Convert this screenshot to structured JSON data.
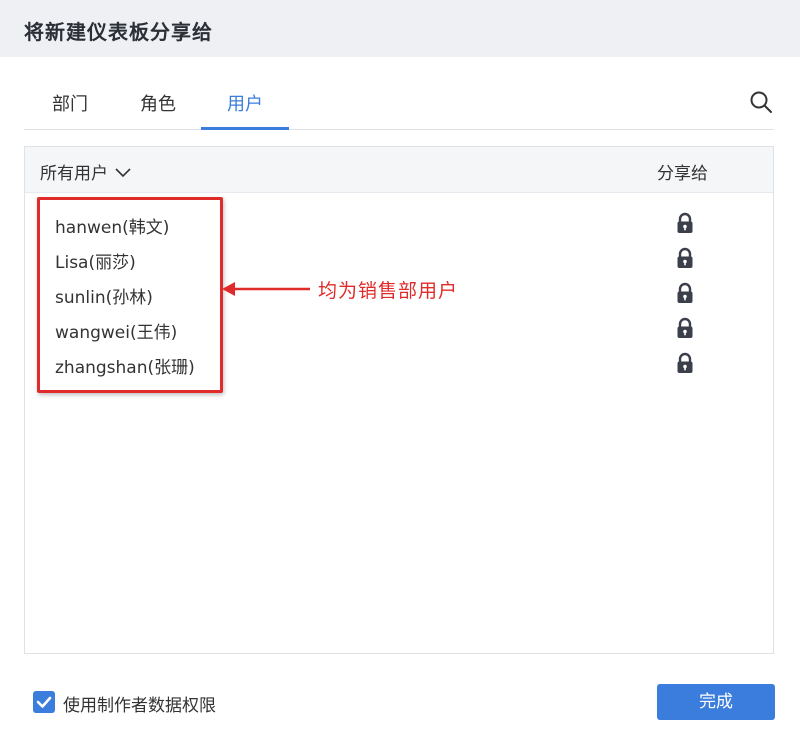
{
  "dialog": {
    "title": "将新建仪表板分享给"
  },
  "tabs": [
    {
      "label": "部门",
      "active": false
    },
    {
      "label": "角色",
      "active": false
    },
    {
      "label": "用户",
      "active": true
    }
  ],
  "search": {
    "icon": "search-icon"
  },
  "panel": {
    "filter_label": "所有用户",
    "share_column_title": "分享给",
    "users": [
      {
        "label": "hanwen(韩文)",
        "share_icon": "lock-icon"
      },
      {
        "label": "Lisa(丽莎)",
        "share_icon": "lock-icon"
      },
      {
        "label": "sunlin(孙林)",
        "share_icon": "lock-icon"
      },
      {
        "label": "wangwei(王伟)",
        "share_icon": "lock-icon"
      },
      {
        "label": "zhangshan(张珊)",
        "share_icon": "lock-icon"
      }
    ]
  },
  "annotation": {
    "text": "均为销售部用户",
    "color": "#e02b2b"
  },
  "footer": {
    "checkbox_label": "使用制作者数据权限",
    "checkbox_checked": true,
    "done_label": "完成"
  },
  "colors": {
    "accent": "#3b7ddd",
    "header_bg": "#eef0f3"
  }
}
